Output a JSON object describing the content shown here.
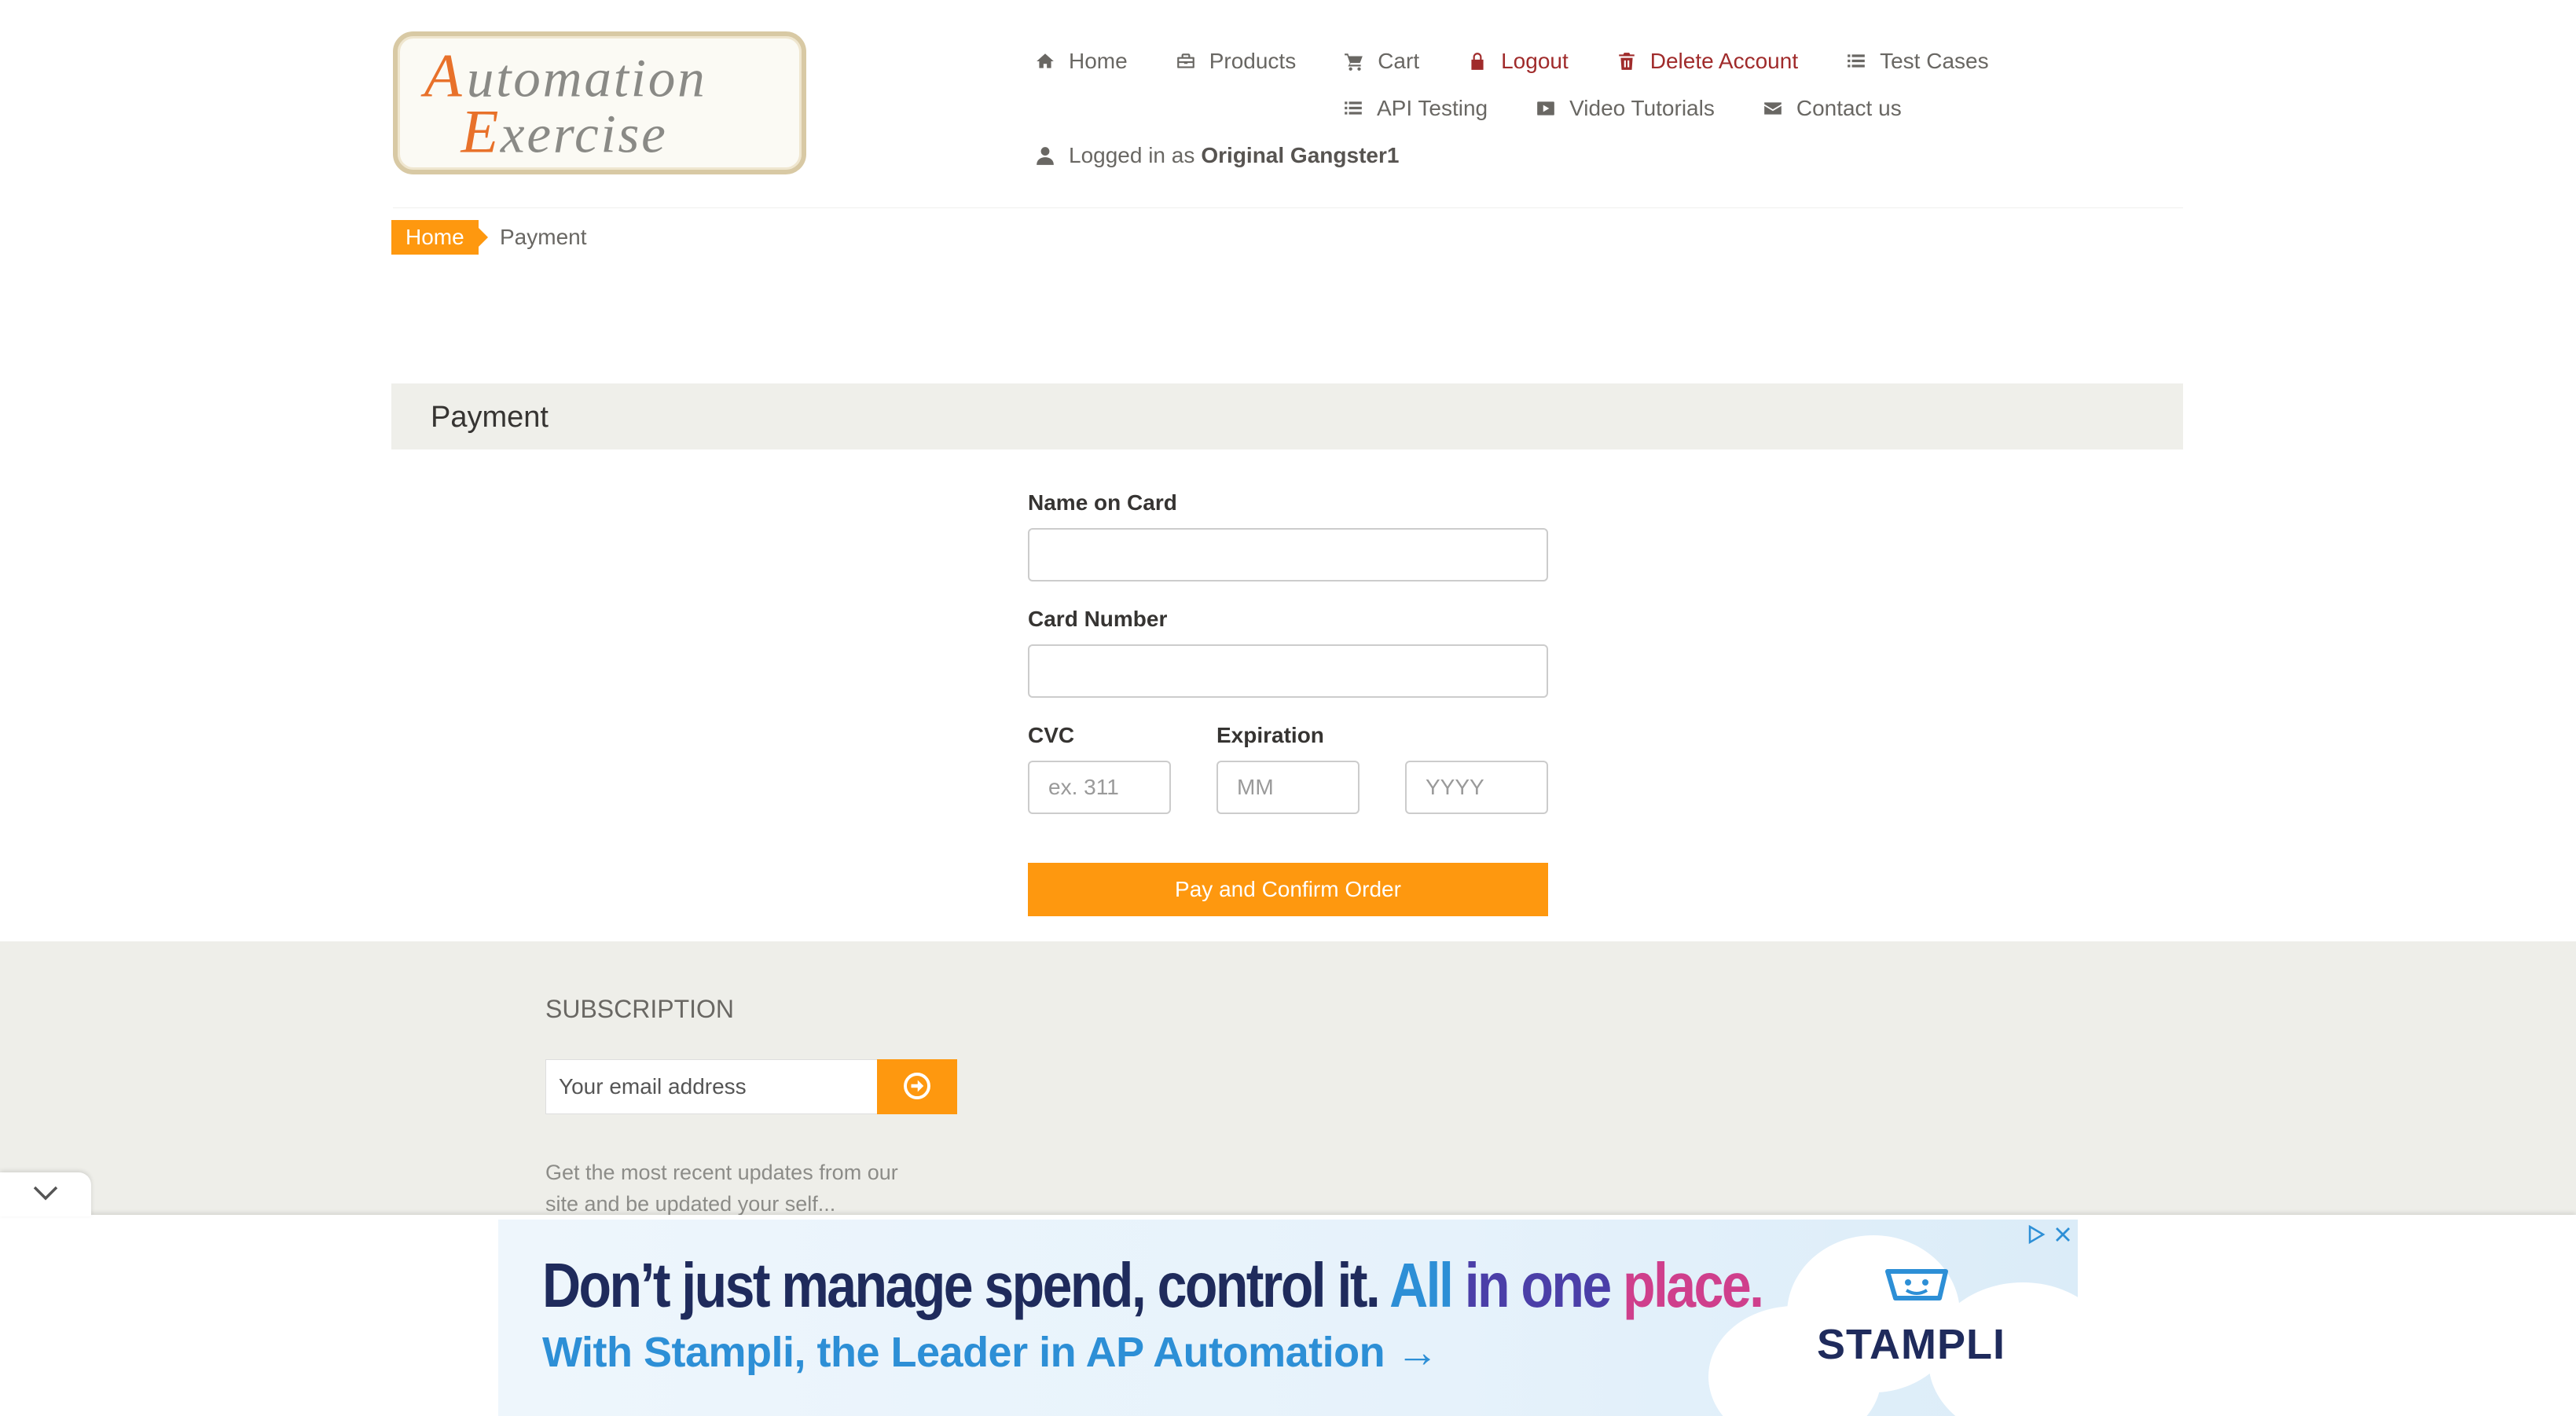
{
  "logo": {
    "line1": "Automation",
    "line2": "Exercise"
  },
  "nav": {
    "home": "Home",
    "products": "Products",
    "cart": "Cart",
    "logout": "Logout",
    "delete_account": "Delete Account",
    "test_cases": "Test Cases",
    "api_testing": "API Testing",
    "video_tutorials": "Video Tutorials",
    "contact_us": "Contact us",
    "logged_in_prefix": "Logged in as",
    "username": "Original Gangster1"
  },
  "breadcrumb": {
    "home": "Home",
    "current": "Payment"
  },
  "payment": {
    "heading": "Payment",
    "name_label": "Name on Card",
    "name_value": "",
    "card_label": "Card Number",
    "card_value": "",
    "cvc_label": "CVC",
    "cvc_placeholder": "ex. 311",
    "expiration_label": "Expiration",
    "month_placeholder": "MM",
    "year_placeholder": "YYYY",
    "submit_label": "Pay and Confirm Order"
  },
  "subscription": {
    "title": "SUBSCRIPTION",
    "email_placeholder": "Your email address",
    "description": "Get the most recent updates from our site and be updated your self..."
  },
  "ad": {
    "headline_a": "Don’t just manage spend, control it.",
    "headline_b": "All",
    "headline_c": "in one",
    "headline_d": "place.",
    "subline": "With Stampli, the Leader in AP Automation →",
    "brand": "STAMPLI"
  },
  "colors": {
    "accent": "#fe980f",
    "danger": "#a02b2b",
    "footer_bg": "#eeeee9",
    "heading_bar": "#efefea"
  },
  "icons": {
    "home": "home-icon",
    "products": "briefcase-icon",
    "cart": "shopping-cart-icon",
    "logout": "lock-icon",
    "delete": "trash-icon",
    "list": "list-icon",
    "video": "youtube-play-icon",
    "contact": "envelope-icon",
    "user": "user-icon",
    "subscribe": "arrow-circle-right-icon",
    "collapse": "chevron-down-icon"
  }
}
